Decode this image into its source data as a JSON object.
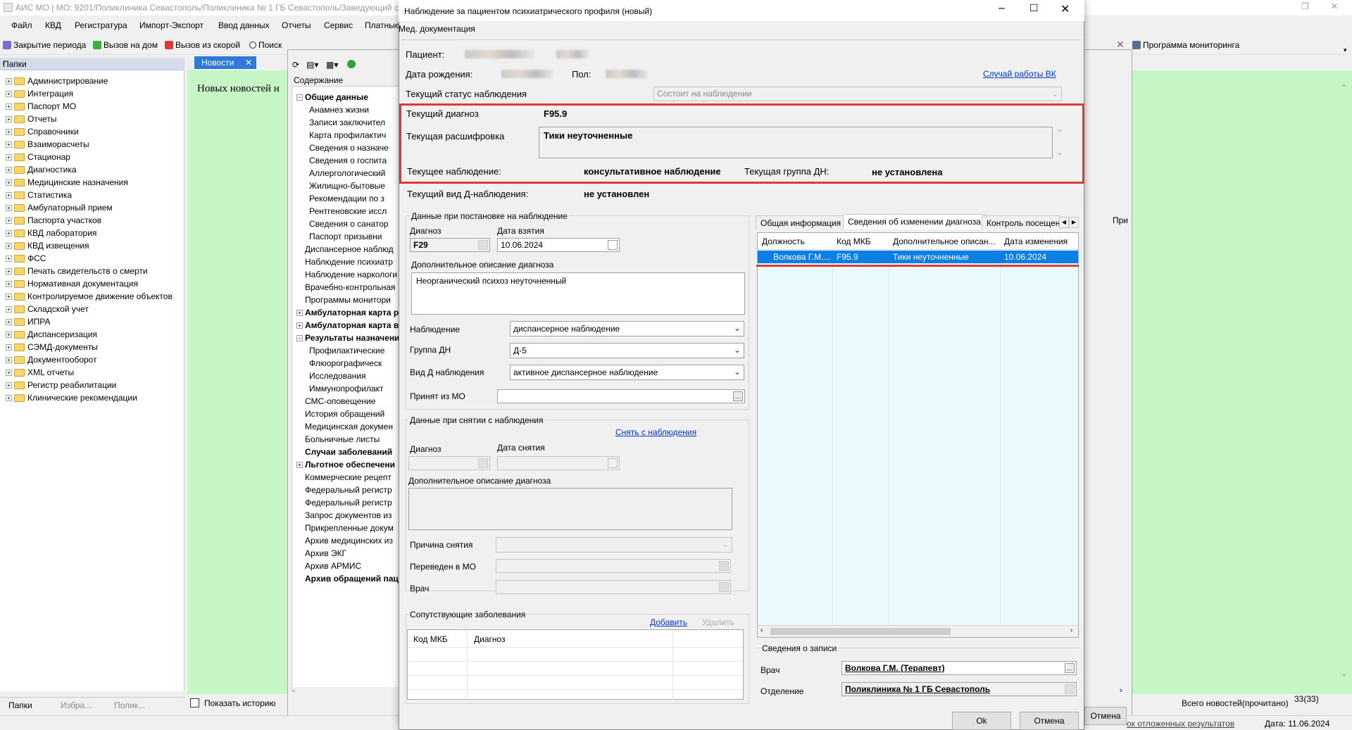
{
  "main_window": {
    "title": "АИС МО | МО: 9201/Поликлиника Севастополь/Поликлиника № 1 ГБ Севастополь/Заведующий с",
    "menu": [
      "Файл",
      "КВД",
      "Регистратура",
      "Импорт-Экспорт",
      "Ввод данных",
      "Отчеты",
      "Сервис",
      "Платные"
    ],
    "toolbar": {
      "close_period": "Закрытие периода",
      "home_call": "Вызов на дом",
      "ambulance_call": "Вызов из скорой",
      "search": "Поиск",
      "monitoring": "Программа мониторинга"
    }
  },
  "folders": {
    "header": "Папки",
    "pin": "ᵻ",
    "items": [
      "Администрирование",
      "Интеграция",
      "Паспорт МО",
      "Отчеты",
      "Справочники",
      "Взаиморасчеты",
      "Стационар",
      "Диагностика",
      "Медицинские назначения",
      "Статистика",
      "Амбулаторный прием",
      "Паспорта участков",
      "КВД лаборатория",
      "КВД извещения",
      "ФСС",
      "Печать свидетельств о смерти",
      "Нормативная документация",
      "Контролируемое движение объектов",
      "Складской учет",
      "ИПРА",
      "Диспансеризация",
      "СЭМД-документы",
      "Документооборот",
      "XML отчеты",
      "Регистр реабилитации",
      "Клинические рекомендации"
    ],
    "bottom_tabs": [
      "Папки",
      "Избра...",
      "Полик..."
    ]
  },
  "news": {
    "tab_label": "Новости",
    "text": "Новых новостей н",
    "show_history": "Показать историю",
    "total": "Всего новостей(прочитано)",
    "count": "33(33)"
  },
  "content_window": {
    "header": "Содержание",
    "items": [
      {
        "label": "Общие данные",
        "bold": true,
        "indent": 0,
        "pm": "−"
      },
      {
        "label": "Анамнез жизни",
        "indent": 1
      },
      {
        "label": "Записи заключител",
        "indent": 1
      },
      {
        "label": "Карта профилактич",
        "indent": 1
      },
      {
        "label": "Сведения о назначе",
        "indent": 1
      },
      {
        "label": "Сведения о госпита",
        "indent": 1
      },
      {
        "label": "Аллергологический",
        "indent": 1
      },
      {
        "label": "Жилищно-бытовые",
        "indent": 1
      },
      {
        "label": "Рекомендации по з",
        "indent": 1
      },
      {
        "label": "Рентгеновские иссл",
        "indent": 1
      },
      {
        "label": "Сведения о санатор",
        "indent": 1
      },
      {
        "label": "Паспорт призывни",
        "indent": 1
      },
      {
        "label": "Диспансерное наблюд",
        "indent": 0
      },
      {
        "label": "Наблюдение психиатр",
        "indent": 0
      },
      {
        "label": "Наблюдение наркологи",
        "indent": 0
      },
      {
        "label": "Врачебно-контрольная",
        "indent": 0
      },
      {
        "label": "Программы монитори",
        "indent": 0
      },
      {
        "label": "Амбулаторная карта р",
        "bold": true,
        "indent": 0,
        "pm": "+"
      },
      {
        "label": "Амбулаторная карта в",
        "bold": true,
        "indent": 0,
        "pm": "+"
      },
      {
        "label": "Результаты назначени",
        "bold": true,
        "indent": 0,
        "pm": "−"
      },
      {
        "label": "Профилактические",
        "indent": 1
      },
      {
        "label": "Флюорографическ",
        "indent": 1
      },
      {
        "label": "Исследования",
        "indent": 1
      },
      {
        "label": "Иммунопрофилакт",
        "indent": 1
      },
      {
        "label": "СМС-оповещение",
        "indent": 0
      },
      {
        "label": "История обращений",
        "indent": 0
      },
      {
        "label": "Медицинская докумен",
        "indent": 0
      },
      {
        "label": "Больничные листы",
        "indent": 0
      },
      {
        "label": "Случаи заболеваний",
        "bold": true,
        "indent": 0
      },
      {
        "label": "Льготное обеспечени",
        "bold": true,
        "indent": 0,
        "pm": "+"
      },
      {
        "label": "Коммерческие рецепт",
        "indent": 0
      },
      {
        "label": "Федеральный регистр",
        "indent": 0
      },
      {
        "label": "Федеральный регистр",
        "indent": 0
      },
      {
        "label": "Запрос документов из",
        "indent": 0
      },
      {
        "label": "Прикрепленные докум",
        "indent": 0
      },
      {
        "label": "Архив медицинских из",
        "indent": 0
      },
      {
        "label": "Архив ЭКГ",
        "indent": 0
      },
      {
        "label": "Архив АРМИС",
        "indent": 0
      },
      {
        "label": "Архив обращений паци",
        "bold": true,
        "indent": 0
      }
    ]
  },
  "dialog": {
    "title": "Наблюдение за пациентом психиатрического профиля (новый)",
    "menu": "Мед. документация",
    "patient_label": "Пациент:",
    "dob_label": "Дата рождения:",
    "sex_label": "Пол:",
    "vk_link": "Случай работы ВК",
    "status_label": "Текущий статус наблюдения",
    "status_value": "Состоит на наблюдении",
    "diag_label": "Текущий диагноз",
    "diag_value": "F95.9",
    "decode_label": "Текущая расшифровка",
    "decode_value": "Тики неуточненные",
    "observation_label": "Текущее наблюдение:",
    "observation_value": "консультативное наблюдение",
    "dn_group_label": "Текущая группа ДН:",
    "dn_group_value": "не установлена",
    "d_type_label": "Текущий вид Д-наблюдения:",
    "d_type_value": "не установлен",
    "reg": {
      "group_title": "Данные при постановке на наблюдение",
      "diag_label": "Диагноз",
      "diag_value": "F29",
      "date_label": "Дата взятия",
      "date_value": "10.06.2024",
      "extra_label": "Дополнительное описание диагноза",
      "extra_value": "Неорганический психоз неуточненный",
      "obs_label": "Наблюдение",
      "obs_value": "диспансерное наблюдение",
      "group_label": "Группа ДН",
      "group_value": "Д-5",
      "type_label": "Вид Д наблюдения",
      "type_value": "активное диспансерное наблюдение",
      "from_label": "Принят из МО"
    },
    "dereg": {
      "group_title": "Данные при снятии с наблюдения",
      "remove_link": "Снять с наблюдения",
      "diag_label": "Диагноз",
      "date_label": "Дата снятия",
      "extra_label": "Дополнительное описание диагноза",
      "reason_label": "Причина снятия",
      "moved_label": "Переведен в МО",
      "doctor_label": "Врач"
    },
    "comorbid": {
      "title": "Сопутствующие заболевания",
      "add": "Добавить",
      "delete": "Удалить",
      "col_code": "Код МКБ",
      "col_diag": "Диагноз"
    },
    "tabs": [
      "Общая информация",
      "Сведения об изменении диагноза",
      "Контроль посещен"
    ],
    "grid": {
      "columns": [
        "Должность",
        "Код МКБ",
        "Дополнительное описан...",
        "Дата изменения"
      ],
      "rows": [
        [
          "Волкова Г.М....",
          "F95.9",
          "Тики неуточненные",
          "10.06.2024"
        ]
      ]
    },
    "record": {
      "title": "Сведения о записи",
      "doctor_label": "Врач",
      "doctor_value": "Волкова Г.М. (Терапевт)",
      "dept_label": "Отделение",
      "dept_value": "Поликлиника № 1 ГБ Севастополь"
    },
    "ok": "Ok",
    "cancel": "Отмена"
  },
  "status_bar": {
    "left_link": "ок отложенных результатов",
    "date": "Дата: 11.06.2024",
    "cancel_btn": "Отмена",
    "pri": "При"
  },
  "colors": {
    "news_bg": "#c6f6c6",
    "accent": "#2e7ad6",
    "selection": "#0d7ee6",
    "highlight": "#d93a3a"
  }
}
